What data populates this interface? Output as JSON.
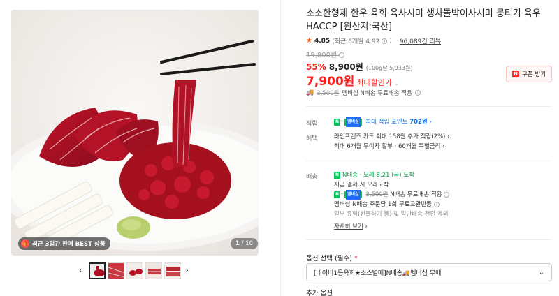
{
  "gallery": {
    "badge_label": "최근 3일간 판매 BEST 상품",
    "counter_current": "1",
    "counter_total": "/ 10",
    "prev_arrow": "‹",
    "next_arrow": "›"
  },
  "product": {
    "title": "소소한형제 한우 육회 육사시미 생차돌박이사시미 뭉티기 육우 HACCP [원산지:국산]",
    "rating_score": "4.85",
    "rating_recent": "(최근 6개월 4.92",
    "rating_recent_close": ")",
    "review_count": "96,089건 리뷰",
    "original_price": "19,800원",
    "discount_rate": "55%",
    "sale_price": "8,900원",
    "unit_price": "(100g당 5,933원)",
    "max_discount_amount": "7,900원",
    "max_discount_label": "최대할인가",
    "coupon_label": "쿠폰 받기",
    "shipping_original": "3,500원",
    "shipping_text": "멤버십 N배송 무료배송 적용"
  },
  "benefits": {
    "points_label": "적립",
    "points_text": "최대 적립 포인트",
    "points_value": "702원",
    "benefit_label": "혜택",
    "benefit_line1": "라인프렌즈 카드 최대 158원 추가 적립(2%)",
    "benefit_line2": "최대 6개월 무이자 할부 · 60개월 특별금리",
    "delivery_label": "배송",
    "delivery_badge": "N배송",
    "delivery_eta": "· 모레 8.21 (금) 도착",
    "delivery_note": "지금 결제 시 모레도착",
    "delivery_ship_original": "3,500원",
    "delivery_ship_text": "N배송 무료배송 적용",
    "delivery_return": "멤버십 N배송 주문당 1회 무료교환반품",
    "delivery_exception": "일부 유형(선물하기 등) 및 일반배송 전환 제외",
    "details_link": "자세히 보기"
  },
  "options": {
    "label": "옵션 선택 (필수)",
    "required_mark": "*",
    "selected_value": "[네이버1등육회★소스별매]N배송🚚멤버십 무배",
    "additional_label": "추가 옵션"
  },
  "colors": {
    "accent_red": "#ff1e1e",
    "naver_green": "#03c75a",
    "link_blue": "#0d6fe8"
  }
}
